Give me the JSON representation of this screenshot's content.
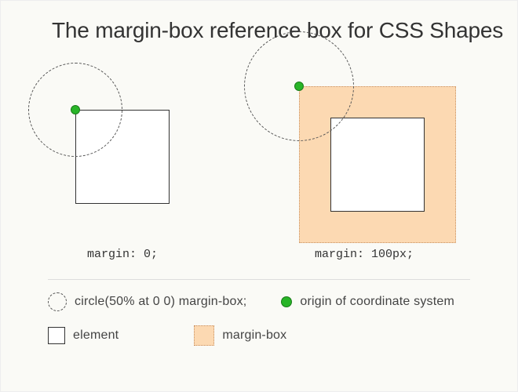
{
  "title": "The margin-box reference box for CSS Shapes",
  "examples": {
    "left": {
      "caption": "margin: 0;"
    },
    "right": {
      "caption": "margin: 100px;"
    }
  },
  "legend": {
    "circle": "circle(50% at 0 0) margin-box;",
    "origin": "origin of coordinate system",
    "element": "element",
    "margin_box": "margin-box"
  }
}
